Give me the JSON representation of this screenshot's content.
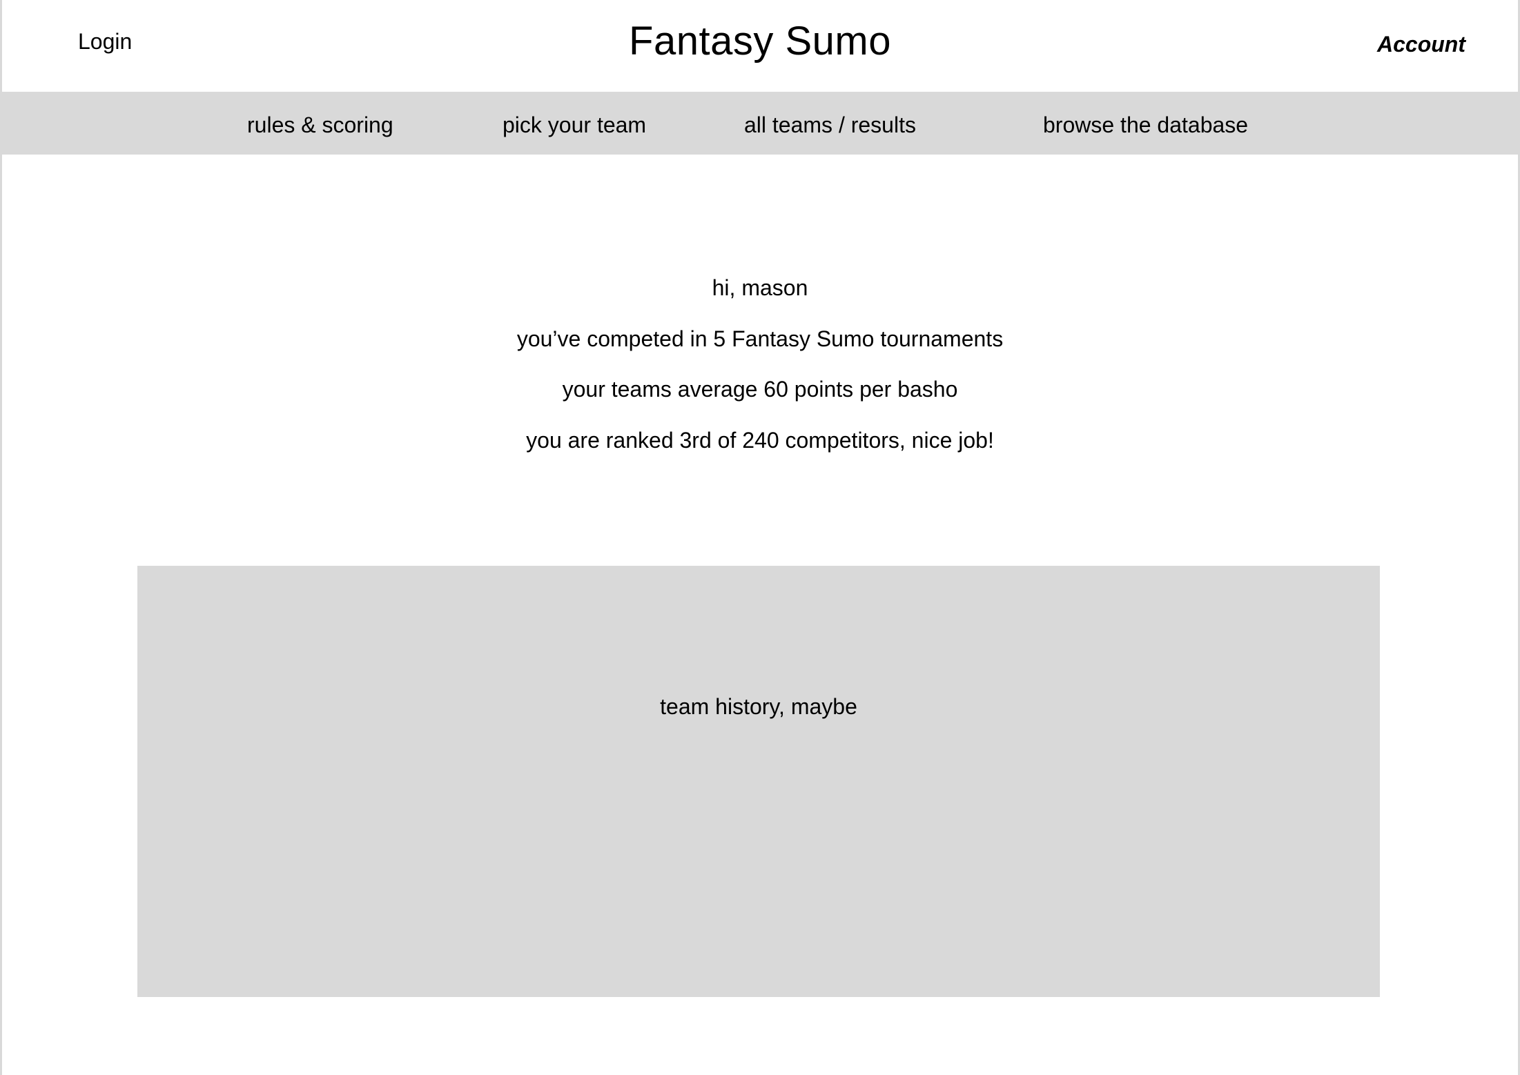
{
  "header": {
    "login_label": "Login",
    "site_title": "Fantasy Sumo",
    "account_label": "Account"
  },
  "nav": {
    "items": [
      {
        "label": "rules & scoring"
      },
      {
        "label": "pick your team"
      },
      {
        "label": "all teams / results"
      },
      {
        "label": "browse the database"
      }
    ]
  },
  "summary": {
    "greeting": "hi, mason",
    "tournaments": "you’ve competed in 5 Fantasy Sumo tournaments",
    "average": "your teams average 60 points per basho",
    "rank": "you are ranked 3rd of 240 competitors, nice job!"
  },
  "history": {
    "placeholder": "team history, maybe"
  },
  "colors": {
    "nav_background": "#d9d9d9",
    "panel_background": "#d9d9d9",
    "text": "#000000",
    "page_background": "#ffffff"
  }
}
